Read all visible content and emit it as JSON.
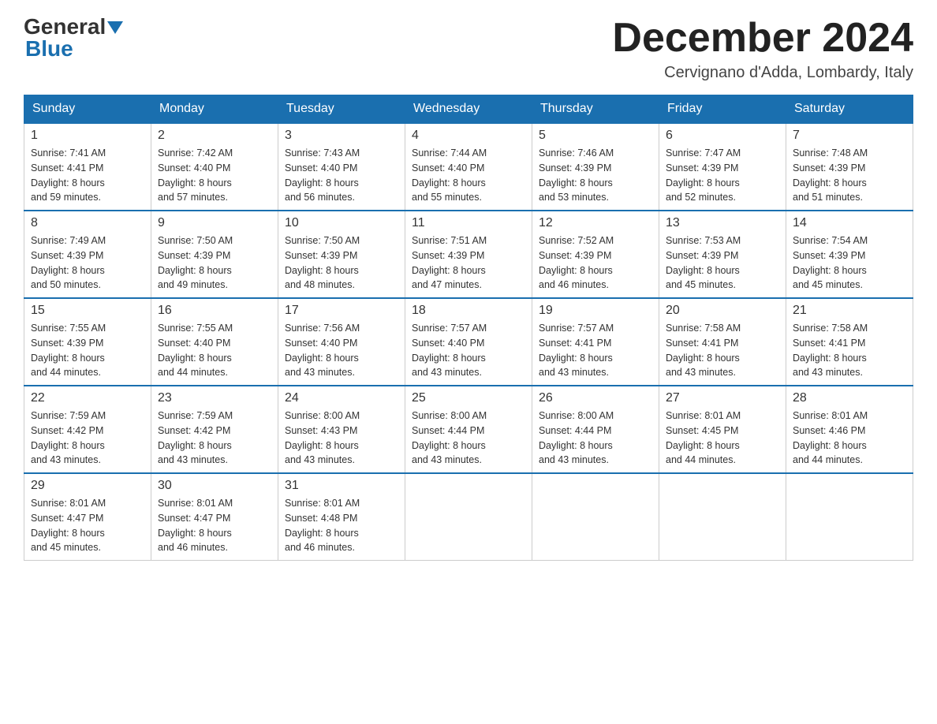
{
  "logo": {
    "general": "General",
    "blue": "Blue"
  },
  "title": "December 2024",
  "location": "Cervignano d'Adda, Lombardy, Italy",
  "days_of_week": [
    "Sunday",
    "Monday",
    "Tuesday",
    "Wednesday",
    "Thursday",
    "Friday",
    "Saturday"
  ],
  "weeks": [
    [
      {
        "day": "1",
        "sunrise": "7:41 AM",
        "sunset": "4:41 PM",
        "daylight": "8 hours and 59 minutes."
      },
      {
        "day": "2",
        "sunrise": "7:42 AM",
        "sunset": "4:40 PM",
        "daylight": "8 hours and 57 minutes."
      },
      {
        "day": "3",
        "sunrise": "7:43 AM",
        "sunset": "4:40 PM",
        "daylight": "8 hours and 56 minutes."
      },
      {
        "day": "4",
        "sunrise": "7:44 AM",
        "sunset": "4:40 PM",
        "daylight": "8 hours and 55 minutes."
      },
      {
        "day": "5",
        "sunrise": "7:46 AM",
        "sunset": "4:39 PM",
        "daylight": "8 hours and 53 minutes."
      },
      {
        "day": "6",
        "sunrise": "7:47 AM",
        "sunset": "4:39 PM",
        "daylight": "8 hours and 52 minutes."
      },
      {
        "day": "7",
        "sunrise": "7:48 AM",
        "sunset": "4:39 PM",
        "daylight": "8 hours and 51 minutes."
      }
    ],
    [
      {
        "day": "8",
        "sunrise": "7:49 AM",
        "sunset": "4:39 PM",
        "daylight": "8 hours and 50 minutes."
      },
      {
        "day": "9",
        "sunrise": "7:50 AM",
        "sunset": "4:39 PM",
        "daylight": "8 hours and 49 minutes."
      },
      {
        "day": "10",
        "sunrise": "7:50 AM",
        "sunset": "4:39 PM",
        "daylight": "8 hours and 48 minutes."
      },
      {
        "day": "11",
        "sunrise": "7:51 AM",
        "sunset": "4:39 PM",
        "daylight": "8 hours and 47 minutes."
      },
      {
        "day": "12",
        "sunrise": "7:52 AM",
        "sunset": "4:39 PM",
        "daylight": "8 hours and 46 minutes."
      },
      {
        "day": "13",
        "sunrise": "7:53 AM",
        "sunset": "4:39 PM",
        "daylight": "8 hours and 45 minutes."
      },
      {
        "day": "14",
        "sunrise": "7:54 AM",
        "sunset": "4:39 PM",
        "daylight": "8 hours and 45 minutes."
      }
    ],
    [
      {
        "day": "15",
        "sunrise": "7:55 AM",
        "sunset": "4:39 PM",
        "daylight": "8 hours and 44 minutes."
      },
      {
        "day": "16",
        "sunrise": "7:55 AM",
        "sunset": "4:40 PM",
        "daylight": "8 hours and 44 minutes."
      },
      {
        "day": "17",
        "sunrise": "7:56 AM",
        "sunset": "4:40 PM",
        "daylight": "8 hours and 43 minutes."
      },
      {
        "day": "18",
        "sunrise": "7:57 AM",
        "sunset": "4:40 PM",
        "daylight": "8 hours and 43 minutes."
      },
      {
        "day": "19",
        "sunrise": "7:57 AM",
        "sunset": "4:41 PM",
        "daylight": "8 hours and 43 minutes."
      },
      {
        "day": "20",
        "sunrise": "7:58 AM",
        "sunset": "4:41 PM",
        "daylight": "8 hours and 43 minutes."
      },
      {
        "day": "21",
        "sunrise": "7:58 AM",
        "sunset": "4:41 PM",
        "daylight": "8 hours and 43 minutes."
      }
    ],
    [
      {
        "day": "22",
        "sunrise": "7:59 AM",
        "sunset": "4:42 PM",
        "daylight": "8 hours and 43 minutes."
      },
      {
        "day": "23",
        "sunrise": "7:59 AM",
        "sunset": "4:42 PM",
        "daylight": "8 hours and 43 minutes."
      },
      {
        "day": "24",
        "sunrise": "8:00 AM",
        "sunset": "4:43 PM",
        "daylight": "8 hours and 43 minutes."
      },
      {
        "day": "25",
        "sunrise": "8:00 AM",
        "sunset": "4:44 PM",
        "daylight": "8 hours and 43 minutes."
      },
      {
        "day": "26",
        "sunrise": "8:00 AM",
        "sunset": "4:44 PM",
        "daylight": "8 hours and 43 minutes."
      },
      {
        "day": "27",
        "sunrise": "8:01 AM",
        "sunset": "4:45 PM",
        "daylight": "8 hours and 44 minutes."
      },
      {
        "day": "28",
        "sunrise": "8:01 AM",
        "sunset": "4:46 PM",
        "daylight": "8 hours and 44 minutes."
      }
    ],
    [
      {
        "day": "29",
        "sunrise": "8:01 AM",
        "sunset": "4:47 PM",
        "daylight": "8 hours and 45 minutes."
      },
      {
        "day": "30",
        "sunrise": "8:01 AM",
        "sunset": "4:47 PM",
        "daylight": "8 hours and 46 minutes."
      },
      {
        "day": "31",
        "sunrise": "8:01 AM",
        "sunset": "4:48 PM",
        "daylight": "8 hours and 46 minutes."
      },
      null,
      null,
      null,
      null
    ]
  ]
}
